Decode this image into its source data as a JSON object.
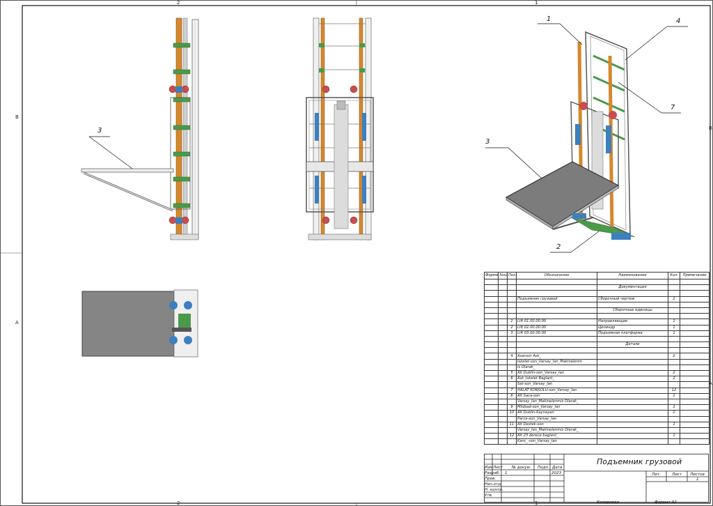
{
  "zones": {
    "top_left": "2",
    "top_right": "1",
    "bottom_left": "2",
    "bottom_right": "1",
    "left_b": "B",
    "left_a": "A",
    "right_b": "B",
    "right_a": "A"
  },
  "callouts": {
    "side_view": [
      "3"
    ],
    "iso_view": [
      "1",
      "4",
      "7",
      "3",
      "2"
    ]
  },
  "spec_table": {
    "headers": [
      "Формат",
      "Зона",
      "Поз.",
      "Обозначение",
      "Наименование",
      "Кол.",
      "Примечание"
    ],
    "rows": [
      [
        "",
        "",
        "",
        "",
        "",
        "",
        ""
      ],
      [
        "",
        "",
        "",
        "",
        "Документация",
        "",
        ""
      ],
      [
        "",
        "",
        "",
        "",
        "",
        "",
        ""
      ],
      [
        "",
        "",
        "",
        "Подъемник грузовой",
        "Сборочный чертеж",
        "1",
        ""
      ],
      [
        "",
        "",
        "",
        "",
        "",
        "",
        ""
      ],
      [
        "",
        "",
        "",
        "",
        "Сборочные единицы",
        "",
        ""
      ],
      [
        "",
        "",
        "",
        "",
        "",
        "",
        ""
      ],
      [
        "",
        "",
        "1",
        "Lift 01.00.00.00",
        "Направляющие",
        "1",
        ""
      ],
      [
        "",
        "",
        "2",
        "Lift 02.00.00.00",
        "Цилиндр",
        "1",
        ""
      ],
      [
        "",
        "",
        "3",
        "Lift 03.00.00.00",
        "Подъемная платформа",
        "1",
        ""
      ],
      [
        "",
        "",
        "",
        "",
        "",
        "",
        ""
      ],
      [
        "",
        "",
        "",
        "",
        "Детали",
        "",
        ""
      ],
      [
        "",
        "",
        "",
        "",
        "",
        "",
        ""
      ],
      [
        "",
        "",
        "4",
        "Asansor Ask_",
        "",
        "2",
        ""
      ],
      [
        "",
        "",
        "",
        "Iskelet-son_Varsay_Ian_Makinelenm",
        "",
        "",
        ""
      ],
      [
        "",
        "",
        "",
        "is Olarak_",
        "",
        "",
        ""
      ],
      [
        "",
        "",
        "5",
        "Alt Dublin-son_Varsay_Ian",
        "",
        "2",
        ""
      ],
      [
        "",
        "",
        "6",
        "Ask_Iskelet Baglant_",
        "",
        "2",
        ""
      ],
      [
        "",
        "",
        "",
        "Sat-son_Varsay_Ian",
        "",
        "",
        ""
      ],
      [
        "",
        "",
        "7",
        "HALAT KONSOLU-son_Varsay_Ian",
        "",
        "12",
        ""
      ],
      [
        "",
        "",
        "8",
        "Alt Saca-son",
        "",
        "1",
        ""
      ],
      [
        "",
        "",
        "",
        "Varsay_Ian_Makinelenmis Olarak_",
        "",
        "",
        ""
      ],
      [
        "",
        "",
        "9",
        "Mildsad-son_Varsay_Ian",
        "",
        "1",
        ""
      ],
      [
        "",
        "",
        "10",
        "Alt Dublin-Kaynayan",
        "",
        "2",
        ""
      ],
      [
        "",
        "",
        "",
        "Parca-son_Varsay_Ian",
        "",
        "",
        ""
      ],
      [
        "",
        "",
        "11",
        "Alt Destek-son",
        "",
        "1",
        ""
      ],
      [
        "",
        "",
        "",
        "Varsay_Ian_Makinelenmis Olarak_",
        "",
        "",
        ""
      ],
      [
        "",
        "",
        "12",
        "Alt 23 derece baglant_",
        "",
        "1",
        ""
      ],
      [
        "",
        "",
        "",
        "Kanc_-son_Varsay_Ian",
        "",
        "",
        ""
      ]
    ]
  },
  "title_block": {
    "title": "Подъемник грузовой",
    "col_izm": "Изм",
    "col_list": "Лист",
    "col_docnum": "№ докум.",
    "col_sign": "Подп.",
    "col_date": "Дата",
    "row_razrab": "Разраб.",
    "row_prov": "Пров.",
    "row_nach": "Нач.отд",
    "row_nkontr": "Н. контр.",
    "row_utv": "Утв.",
    "sign_cell": "1",
    "date_cell": "2023",
    "lit": "Лит.",
    "list": "Лист",
    "listov": "Листов",
    "listov_val": "1",
    "copied": "Копировал",
    "format": "Формат A2"
  }
}
